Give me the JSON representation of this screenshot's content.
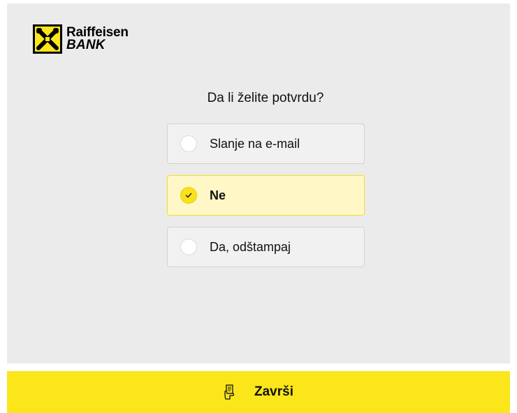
{
  "brand": {
    "name": "Raiffeisen",
    "sub": "BANK",
    "logo_icon": "raiffeisen-gable-cross-icon",
    "colors": {
      "yellow": "#fbe61b",
      "black": "#000000"
    }
  },
  "question": "Da li želite potvrdu?",
  "options": [
    {
      "label": "Slanje na e-mail",
      "selected": false
    },
    {
      "label": "Ne",
      "selected": true
    },
    {
      "label": "Da, odštampaj",
      "selected": false
    }
  ],
  "finish_button": {
    "label": "Završi",
    "icon": "receipt-hand-icon"
  }
}
